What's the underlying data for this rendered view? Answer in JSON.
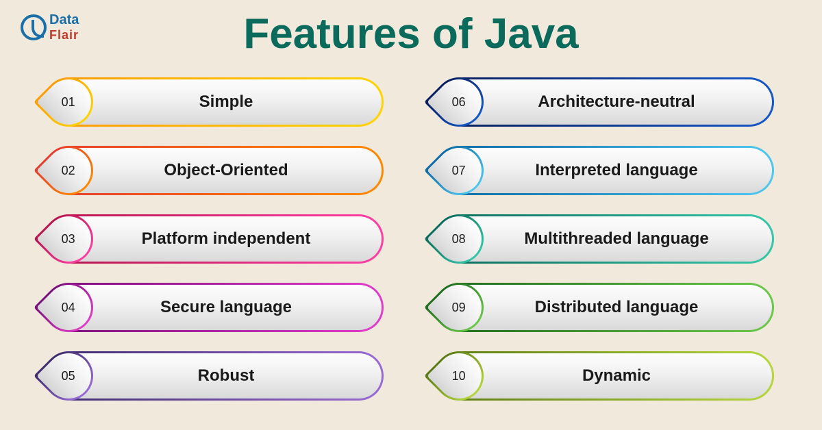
{
  "logo": {
    "line1": "Data",
    "line2": "Flair"
  },
  "title": "Features of Java",
  "left": [
    {
      "num": "01",
      "label": "Simple",
      "g1": "#ff9a00",
      "g2": "#ffd400"
    },
    {
      "num": "02",
      "label": "Object-Oriented",
      "g1": "#e73c2f",
      "g2": "#ff8a00"
    },
    {
      "num": "03",
      "label": "Platform independent",
      "g1": "#b6134c",
      "g2": "#ff3fa4"
    },
    {
      "num": "04",
      "label": "Secure language",
      "g1": "#7a0f7a",
      "g2": "#e23dcb"
    },
    {
      "num": "05",
      "label": "Robust",
      "g1": "#3d2a6d",
      "g2": "#9a6bd6"
    }
  ],
  "right": [
    {
      "num": "06",
      "label": "Architecture-neutral",
      "g1": "#0a1d5e",
      "g2": "#1458c7"
    },
    {
      "num": "07",
      "label": "Interpreted language",
      "g1": "#0b6aa4",
      "g2": "#4fc8f0"
    },
    {
      "num": "08",
      "label": "Multithreaded language",
      "g1": "#0a6b5c",
      "g2": "#34c7a8"
    },
    {
      "num": "09",
      "label": "Distributed language",
      "g1": "#1f6b1f",
      "g2": "#6cc94a"
    },
    {
      "num": "10",
      "label": "Dynamic",
      "g1": "#5a7a12",
      "g2": "#b6d63c"
    }
  ]
}
